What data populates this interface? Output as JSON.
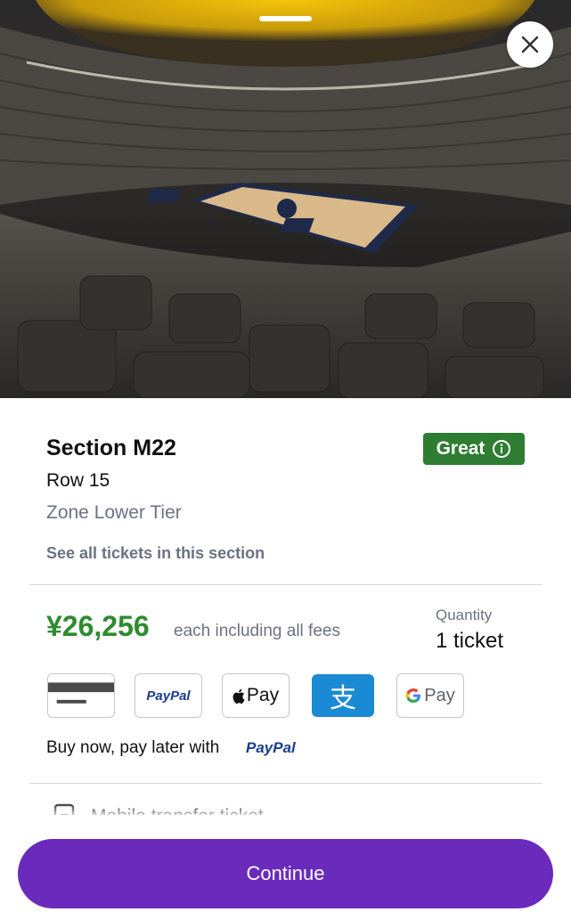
{
  "hero": {
    "image_alt": "Arena seat view"
  },
  "section": {
    "title": "Section M22",
    "row": "Row 15",
    "zone": "Zone Lower Tier",
    "see_all": "See all tickets in this section",
    "badge": "Great"
  },
  "price": {
    "amount": "¥26,256",
    "note": "each including all fees",
    "quantity_label": "Quantity",
    "quantity_value": "1 ticket"
  },
  "payment_methods": {
    "card": "card",
    "paypal": "PayPal",
    "apple_pay": "Pay",
    "alipay": "支",
    "google_pay": "Pay"
  },
  "pay_later": {
    "text": "Buy now, pay later with",
    "brand": "PayPal"
  },
  "delivery": {
    "text": "Mobile transfer ticket"
  },
  "footer": {
    "continue": "Continue"
  },
  "colors": {
    "accent": "#6a2bbd",
    "great_badge": "#2e7d32",
    "price": "#2e8b2e",
    "muted": "#6b7280"
  }
}
